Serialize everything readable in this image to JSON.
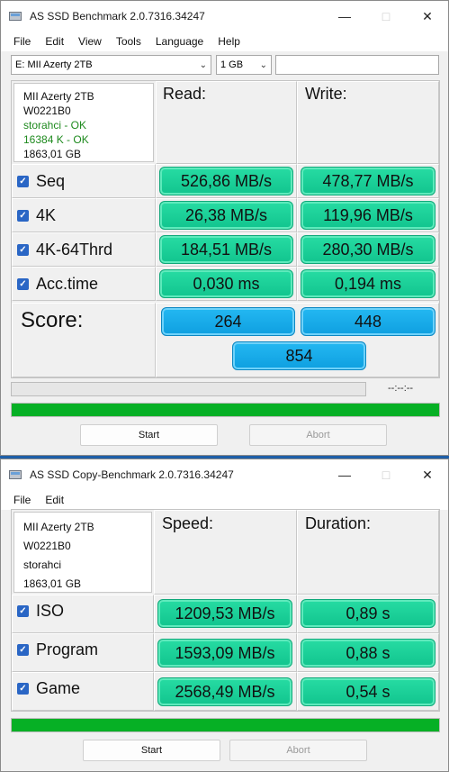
{
  "main_window": {
    "title": "AS SSD Benchmark 2.0.7316.34247",
    "menu": [
      "File",
      "Edit",
      "View",
      "Tools",
      "Language",
      "Help"
    ],
    "drive_select": "E: MII Azerty 2TB",
    "size_select": "1 GB",
    "info": {
      "name": "MII Azerty 2TB",
      "firmware": "W0221B0",
      "driver": "storahci - OK",
      "alignment": "16384 K - OK",
      "capacity": "1863,01 GB"
    },
    "headers": {
      "read": "Read:",
      "write": "Write:"
    },
    "rows": [
      {
        "label": "Seq",
        "read": "526,86 MB/s",
        "write": "478,77 MB/s",
        "checked": true
      },
      {
        "label": "4K",
        "read": "26,38 MB/s",
        "write": "119,96 MB/s",
        "checked": true
      },
      {
        "label": "4K-64Thrd",
        "read": "184,51 MB/s",
        "write": "280,30 MB/s",
        "checked": true
      },
      {
        "label": "Acc.time",
        "read": "0,030 ms",
        "write": "0,194 ms",
        "checked": true
      }
    ],
    "score": {
      "label": "Score:",
      "read": "264",
      "write": "448",
      "total": "854"
    },
    "timer": "--:--:--",
    "progress_top": 0,
    "progress_bottom": 1,
    "start_label": "Start",
    "abort_label": "Abort"
  },
  "copy_window": {
    "title": "AS SSD Copy-Benchmark 2.0.7316.34247",
    "menu": [
      "File",
      "Edit"
    ],
    "info": {
      "name": "MII Azerty 2TB",
      "firmware": "W0221B0",
      "driver": "storahci",
      "capacity": "1863,01 GB"
    },
    "headers": {
      "speed": "Speed:",
      "duration": "Duration:"
    },
    "rows": [
      {
        "label": "ISO",
        "speed": "1209,53 MB/s",
        "duration": "0,89 s",
        "checked": true
      },
      {
        "label": "Program",
        "speed": "1593,09 MB/s",
        "duration": "0,88 s",
        "checked": true
      },
      {
        "label": "Game",
        "speed": "2568,49 MB/s",
        "duration": "0,54 s",
        "checked": true
      }
    ],
    "progress": 1,
    "start_label": "Start",
    "abort_label": "Abort"
  },
  "colors": {
    "value_green": "#1fd49b",
    "score_blue": "#1aaceb",
    "progress_green": "#06b025"
  }
}
